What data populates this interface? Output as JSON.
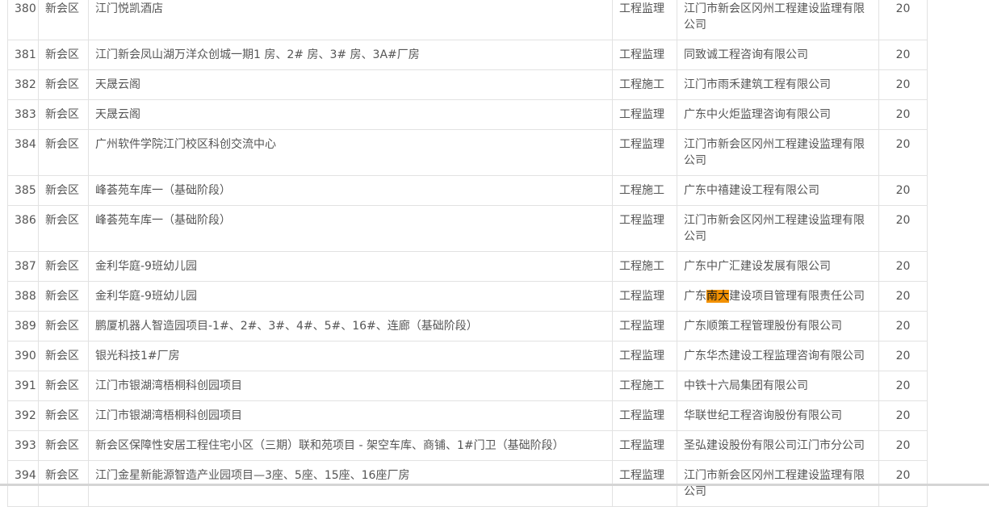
{
  "rows": [
    {
      "no": "380",
      "district": "新会区",
      "project": "江门悦凯酒店",
      "type": "工程监理",
      "company": "江门市新会区冈州工程建设监理有限公司",
      "score": "20"
    },
    {
      "no": "381",
      "district": "新会区",
      "project": "江门新会凤山湖万洋众创城一期1 房、2# 房、3# 房、3A#厂房",
      "type": "工程监理",
      "company": "同致诚工程咨询有限公司",
      "score": "20"
    },
    {
      "no": "382",
      "district": "新会区",
      "project": "天晟云阁",
      "type": "工程施工",
      "company": "江门市雨禾建筑工程有限公司",
      "score": "20"
    },
    {
      "no": "383",
      "district": "新会区",
      "project": "天晟云阁",
      "type": "工程监理",
      "company": "广东中火炬监理咨询有限公司",
      "score": "20"
    },
    {
      "no": "384",
      "district": "新会区",
      "project": "广州软件学院江门校区科创交流中心",
      "type": "工程监理",
      "company": "江门市新会区冈州工程建设监理有限公司",
      "score": "20"
    },
    {
      "no": "385",
      "district": "新会区",
      "project": "峰荟苑车库一（基础阶段）",
      "type": "工程施工",
      "company": "广东中禧建设工程有限公司",
      "score": "20"
    },
    {
      "no": "386",
      "district": "新会区",
      "project": "峰荟苑车库一（基础阶段）",
      "type": "工程监理",
      "company": "江门市新会区冈州工程建设监理有限公司",
      "score": "20"
    },
    {
      "no": "387",
      "district": "新会区",
      "project": "金利华庭-9班幼儿园",
      "type": "工程施工",
      "company": "广东中广汇建设发展有限公司",
      "score": "20"
    },
    {
      "no": "388",
      "district": "新会区",
      "project": "金利华庭-9班幼儿园",
      "type": "工程监理",
      "company_pre": "广东",
      "company_hl": "南大",
      "company_post": "建设项目管理有限责任公司",
      "score": "20"
    },
    {
      "no": "389",
      "district": "新会区",
      "project": "鹏厦机器人智造园项目-1#、2#、3#、4#、5#、16#、连廊（基础阶段）",
      "type": "工程监理",
      "company": "广东顺策工程管理股份有限公司",
      "score": "20"
    },
    {
      "no": "390",
      "district": "新会区",
      "project": "银光科技1#厂房",
      "type": "工程监理",
      "company": "广东华杰建设工程监理咨询有限公司",
      "score": "20"
    },
    {
      "no": "391",
      "district": "新会区",
      "project": "江门市银湖湾梧桐科创园项目",
      "type": "工程施工",
      "company": "中铁十六局集团有限公司",
      "score": "20"
    },
    {
      "no": "392",
      "district": "新会区",
      "project": "江门市银湖湾梧桐科创园项目",
      "type": "工程监理",
      "company": "华联世纪工程咨询股份有限公司",
      "score": "20"
    },
    {
      "no": "393",
      "district": "新会区",
      "project": "新会区保障性安居工程住宅小区（三期）联和苑项目 - 架空车库、商铺、1#门卫（基础阶段）",
      "type": "工程监理",
      "company": "圣弘建设股份有限公司江门市分公司",
      "score": "20"
    },
    {
      "no": "394",
      "district": "新会区",
      "project": "江门金星新能源智造产业园项目—3座、5座、15座、16座厂房",
      "type": "工程监理",
      "company": "江门市新会区冈州工程建设监理有限公司",
      "score": "20"
    }
  ]
}
